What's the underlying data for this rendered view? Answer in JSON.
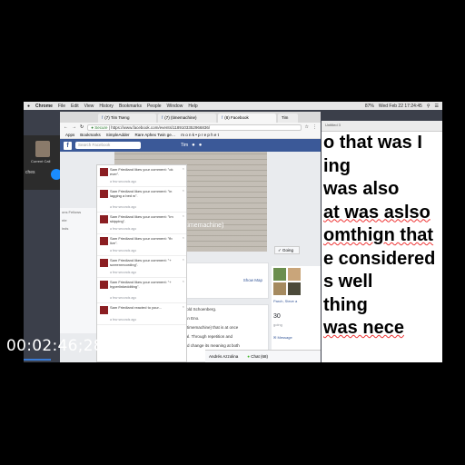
{
  "mac_menu": {
    "apple": "",
    "items": [
      "Chrome",
      "File",
      "Edit",
      "View",
      "History",
      "Bookmarks",
      "People",
      "Window",
      "Help"
    ],
    "clock": "Wed Feb 22  17:24:45",
    "battery": "87%"
  },
  "call": {
    "name": "Current Call",
    "sub": "ches"
  },
  "browser": {
    "tabs": [
      "(7) Tim Tseng",
      "(7) (timemachine)",
      "(8) Facebook",
      "Tim"
    ],
    "secure_label": "Secure",
    "url": "https://www.facebook.com/events/1189103352966836/",
    "bookmarks": [
      "Apps",
      "Bookmarks",
      "SimpleAdder",
      "Rare Aphex Twin ge…",
      "m o n k • p r e p h e t"
    ]
  },
  "facebook": {
    "search_placeholder": "Search Facebook",
    "user_name": "Tim",
    "cover_title": "ne) (timemachine)",
    "event_host": "and Tim Tseng",
    "going_label": "Going",
    "date_text": "ry 27",
    "time_text": "at 10 AM",
    "show_map": "Show Map",
    "desc": [
      "of repetition.\" Arnold Schoenberg.",
      "s of change.\" Brian Eno.",
      "e (timemachine) (timemachine) that is at once",
      "nt from the original. Through repetition and",
      "econtextualize and change its meaning at both"
    ],
    "guests_text": "Parch, Steve a",
    "going_count": "30",
    "going_count_label": "going",
    "message_label": "Message",
    "chat_name": "Andrés Azzolina",
    "chat_label": "Chat (68)",
    "left_strip": [
      "ons Fellows",
      "nte",
      "inds"
    ]
  },
  "notifications": [
    {
      "text": "Sam Friedland likes your comment: \"ok ever\".",
      "time": "a few seconds ago"
    },
    {
      "text": "Sam Friedland likes your comment: \"in lagging a bed w\".",
      "time": "a few seconds ago"
    },
    {
      "text": "Sam Friedland likes your comment: \"Im skipping\".",
      "time": "a few seconds ago"
    },
    {
      "text": "Sam Friedland likes your comment: \"fb live\".",
      "time": "a few seconds ago"
    },
    {
      "text": "Sam Friedland likes your comment: \"+ screenrecording\".",
      "time": "a few seconds ago"
    },
    {
      "text": "Sam Friedland likes your comment: \"+ hyperlinkedditing\".",
      "time": "a few seconds ago"
    },
    {
      "text": "Sam Friedland reacted to your...",
      "time": "a few seconds ago"
    }
  ],
  "document": {
    "toolbar": "Untitled 3",
    "lines": [
      {
        "text": "o that was  I",
        "err": false
      },
      {
        "text": "ing",
        "err": false
      },
      {
        "text": "was also",
        "err": false
      },
      {
        "text": "at was aslso",
        "err": true
      },
      {
        "text": "omthign that",
        "err": true
      },
      {
        "text": "e considered",
        "err": false
      },
      {
        "text": "s well",
        "err": false
      },
      {
        "text": "thing",
        "err": false
      },
      {
        "text": "was nece",
        "err": true
      }
    ]
  },
  "timecode": "00:02:46;28"
}
